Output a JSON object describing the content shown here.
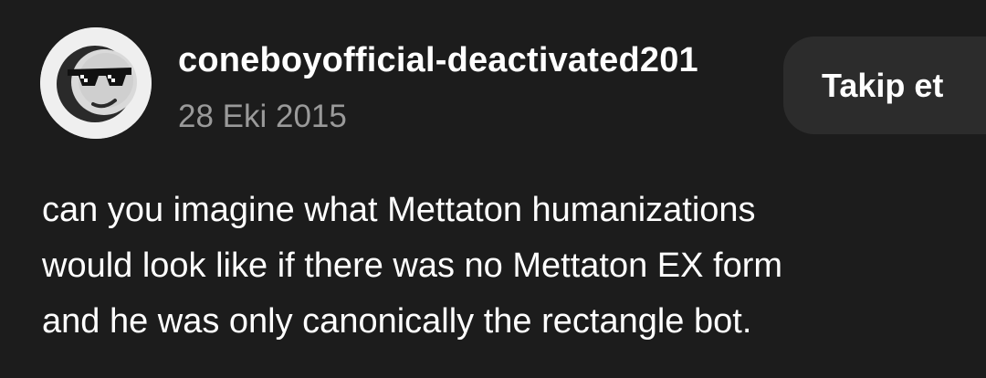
{
  "post": {
    "author": {
      "username": "coneboyofficial-deactivated201",
      "avatar_icon": "sunglasses-face-icon"
    },
    "date": "28 Eki 2015",
    "follow_label": "Takip et",
    "body_lines": [
      "can you imagine what Mettaton humanizations",
      "would look like if there was no Mettaton EX form",
      "and he was only canonically the rectangle bot."
    ]
  },
  "colors": {
    "background": "#1c1c1c",
    "text": "#ffffff",
    "muted_text": "#9a9a9a",
    "button_bg": "#2c2c2c",
    "avatar_bg": "#efefef"
  }
}
